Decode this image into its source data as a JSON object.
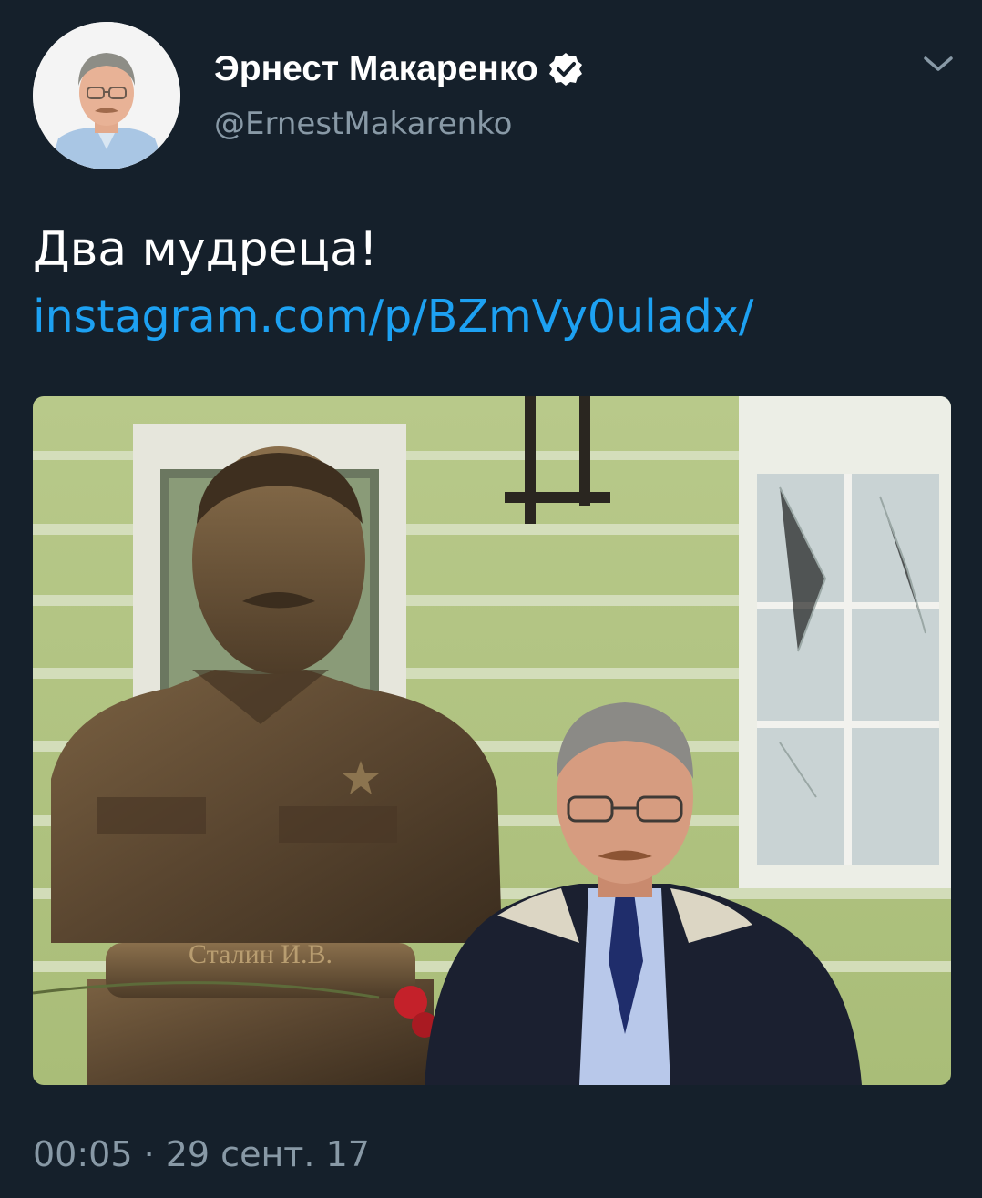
{
  "tweet": {
    "author": {
      "display_name": "Эрнест Макаренко",
      "handle": "@ErnestMakarenko",
      "verified": true,
      "avatar_icon": "profile-photo"
    },
    "text": "Два мудреца!",
    "link": "instagram.com/p/BZmVy0uladx/",
    "media": {
      "bust_inscription": "Сталин И.В."
    },
    "timestamp": "00:05 · 29 сент. 17",
    "menu_icon": "chevron-down-icon"
  },
  "colors": {
    "background": "#15202b",
    "text": "#ffffff",
    "secondary_text": "#8899a6",
    "link": "#1da1f2"
  }
}
